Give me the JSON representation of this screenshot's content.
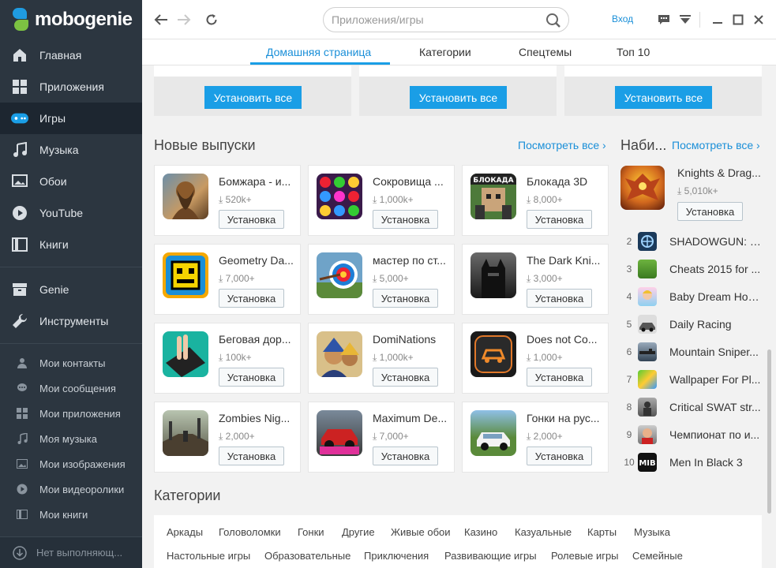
{
  "app": {
    "logo_text": "mobogenie"
  },
  "sidebar": {
    "main_items": [
      {
        "label": "Главная",
        "icon": "home-icon"
      },
      {
        "label": "Приложения",
        "icon": "apps-grid-icon"
      },
      {
        "label": "Игры",
        "icon": "gamepad-icon",
        "active": true
      },
      {
        "label": "Музыка",
        "icon": "music-note-icon"
      },
      {
        "label": "Обои",
        "icon": "wallpaper-icon"
      },
      {
        "label": "YouTube",
        "icon": "play-icon"
      },
      {
        "label": "Книги",
        "icon": "book-icon"
      }
    ],
    "tool_items": [
      {
        "label": "Genie",
        "icon": "genie-box-icon"
      },
      {
        "label": "Инструменты",
        "icon": "wrench-icon"
      }
    ],
    "personal_items": [
      {
        "label": "Мои контакты",
        "icon": "contact-icon"
      },
      {
        "label": "Мои сообщения",
        "icon": "message-icon"
      },
      {
        "label": "Мои приложения",
        "icon": "my-apps-icon"
      },
      {
        "label": "Моя музыка",
        "icon": "my-music-icon"
      },
      {
        "label": "Мои изображения",
        "icon": "image-icon"
      },
      {
        "label": "Мои видеоролики",
        "icon": "video-icon"
      },
      {
        "label": "Мои книги",
        "icon": "my-books-icon"
      }
    ],
    "status_text": "Нет выполняющ..."
  },
  "topbar": {
    "search_placeholder": "Приложения/игры",
    "login_label": "Вход"
  },
  "tabs": [
    {
      "label": "Домашняя страница",
      "active": true
    },
    {
      "label": "Категории"
    },
    {
      "label": "Спецтемы"
    },
    {
      "label": "Топ 10"
    }
  ],
  "install_all_label": "Установить все",
  "new_releases": {
    "title": "Новые выпуски",
    "see_all": "Посмотреть все",
    "install_label": "Установка",
    "items": [
      {
        "name": "Бомжара - и...",
        "downloads": "520k+"
      },
      {
        "name": "Сокровища ...",
        "downloads": "1,000k+"
      },
      {
        "name": "Блокада 3D",
        "downloads": "8,000+"
      },
      {
        "name": "Geometry Da...",
        "downloads": "7,000+"
      },
      {
        "name": "мастер по ст...",
        "downloads": "5,000+"
      },
      {
        "name": "The Dark Kni...",
        "downloads": "3,000+"
      },
      {
        "name": "Беговая дор...",
        "downloads": "100k+"
      },
      {
        "name": "DomiNations",
        "downloads": "1,000k+"
      },
      {
        "name": "Does not Co...",
        "downloads": "1,000+"
      },
      {
        "name": "Zombies Nig...",
        "downloads": "2,000+"
      },
      {
        "name": "Maximum De...",
        "downloads": "7,000+"
      },
      {
        "name": "Гонки на рус...",
        "downloads": "2,000+"
      }
    ]
  },
  "top_list": {
    "title": "Наби...",
    "see_all": "Посмотреть все",
    "first": {
      "name": "Knights & Drag...",
      "downloads": "5,010k+",
      "install_label": "Установка"
    },
    "items": [
      {
        "rank": "2",
        "name": "SHADOWGUN: D..."
      },
      {
        "rank": "3",
        "name": "Cheats 2015 for ..."
      },
      {
        "rank": "4",
        "name": "Baby Dream Hou..."
      },
      {
        "rank": "5",
        "name": "Daily Racing"
      },
      {
        "rank": "6",
        "name": "Mountain Sniper..."
      },
      {
        "rank": "7",
        "name": "Wallpaper For Pl..."
      },
      {
        "rank": "8",
        "name": "Critical SWAT str..."
      },
      {
        "rank": "9",
        "name": "Чемпионат по и..."
      },
      {
        "rank": "10",
        "name": "Men In Black 3"
      }
    ]
  },
  "categories": {
    "title": "Категории",
    "row1": [
      "Аркады",
      "Головоломки",
      "Гонки",
      "Другие",
      "Живые обои",
      "Казино",
      "Казуальные",
      "Карты",
      "Музыка"
    ],
    "row2": [
      "Настольные игры",
      "Образовательные",
      "Приключения",
      "Развивающие игры",
      "Ролевые игры",
      "Семейные"
    ]
  },
  "colors": {
    "accent": "#1a9ee6",
    "sidebar_bg": "#2c3640",
    "link": "#1a8fd8"
  }
}
